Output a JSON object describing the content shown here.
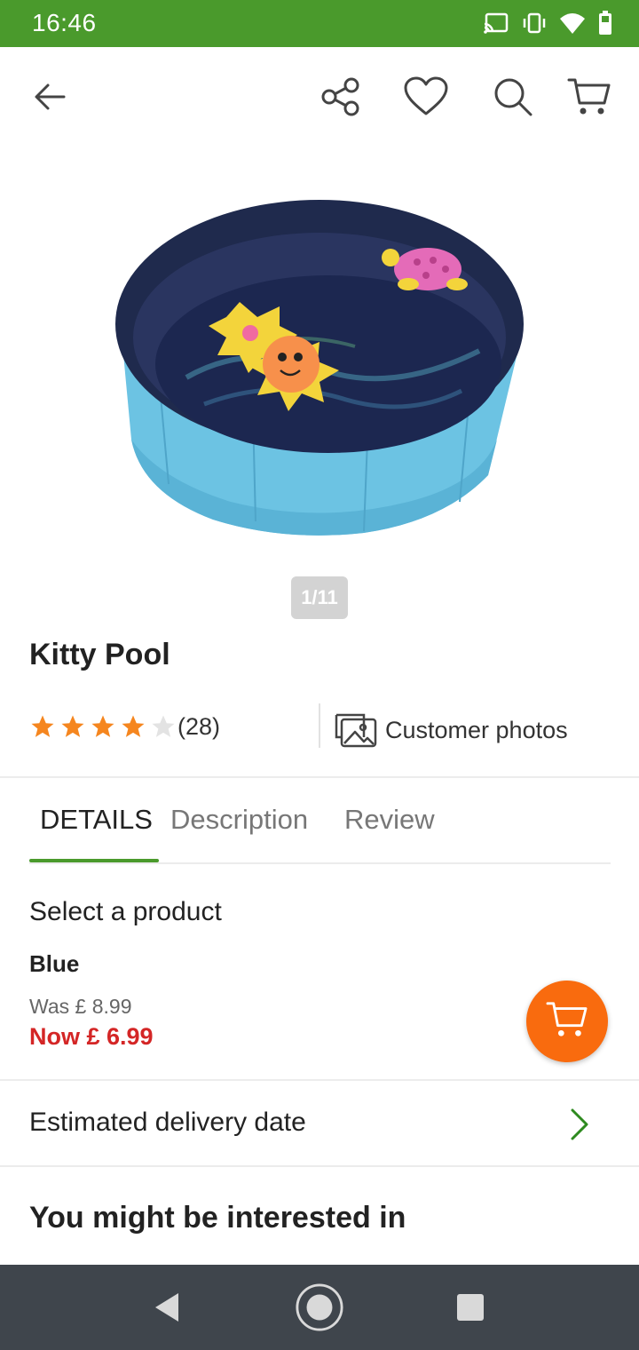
{
  "status_bar": {
    "time": "16:46",
    "icons": [
      "cast-icon",
      "vibrate-icon",
      "wifi-icon",
      "battery-icon"
    ]
  },
  "top_bar": {
    "icons": [
      "back-arrow-icon",
      "share-icon",
      "heart-icon",
      "search-icon",
      "cart-icon"
    ]
  },
  "gallery": {
    "pager": "1/11"
  },
  "product": {
    "title": "Kitty Pool",
    "rating": 4,
    "rating_max": 5,
    "rating_count": "(28)",
    "customer_photos_label": "Customer photos"
  },
  "tabs": [
    {
      "label": "DETAILS",
      "active": true
    },
    {
      "label": "Description",
      "active": false
    },
    {
      "label": "Review",
      "active": false
    }
  ],
  "details": {
    "select_label": "Select a product",
    "variant": "Blue",
    "was_price": "Was £ 8.99",
    "now_price": "Now £ 6.99"
  },
  "delivery": {
    "label": "Estimated delivery date"
  },
  "recommendations": {
    "heading": "You might be interested in"
  },
  "colors": {
    "brand_green": "#4a9a2c",
    "sale_red": "#d42626",
    "fab_orange": "#f96b0e",
    "star_orange": "#f5861f"
  }
}
